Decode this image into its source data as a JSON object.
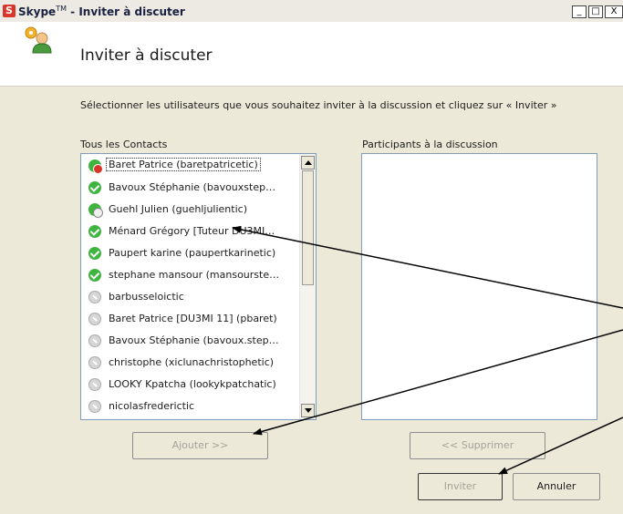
{
  "window": {
    "title_app": "Skype",
    "title_tm": "TM",
    "title_rest": " - Inviter à discuter",
    "app_icon": "S",
    "controls": {
      "minimize": "_",
      "maximize": "□",
      "close": "X"
    }
  },
  "header": {
    "title": "Inviter à discuter",
    "icon": "add-contact-icon"
  },
  "instructions": "Sélectionner les utilisateurs que vous souhaitez inviter à la discussion et cliquez sur « Inviter »",
  "contacts": {
    "label": "Tous les Contacts",
    "items": [
      {
        "name": "Baret Patrice (baretpatricetic)",
        "status": "dnd"
      },
      {
        "name": "Bavoux Stéphanie (bavouxstep…",
        "status": "online"
      },
      {
        "name": "Guehl Julien (guehljulientic)",
        "status": "away"
      },
      {
        "name": "Ménard Grégory [Tuteur DU3MI…",
        "status": "online"
      },
      {
        "name": "Paupert karine (paupertkarinetic)",
        "status": "online"
      },
      {
        "name": "stephane mansour (mansourste…",
        "status": "online"
      },
      {
        "name": "barbusseloictic",
        "status": "offline"
      },
      {
        "name": "Baret Patrice [DU3MI 11] (pbaret)",
        "status": "offline"
      },
      {
        "name": "Bavoux Stéphanie (bavoux.step…",
        "status": "offline"
      },
      {
        "name": "christophe (xiclunachristophetic)",
        "status": "offline"
      },
      {
        "name": "LOOKY Kpatcha (lookykpatchatic)",
        "status": "offline"
      },
      {
        "name": "nicolasfrederictic",
        "status": "offline"
      }
    ]
  },
  "participants": {
    "label": "Participants à la discussion",
    "items": []
  },
  "buttons": {
    "add": "Ajouter >>",
    "remove": "<< Supprimer",
    "invite": "Inviter",
    "cancel": "Annuler"
  },
  "colors": {
    "online": "#3fb53f",
    "dnd": "#d8362a",
    "offline": "#d6d6d6",
    "skype_red": "#d8362a"
  }
}
